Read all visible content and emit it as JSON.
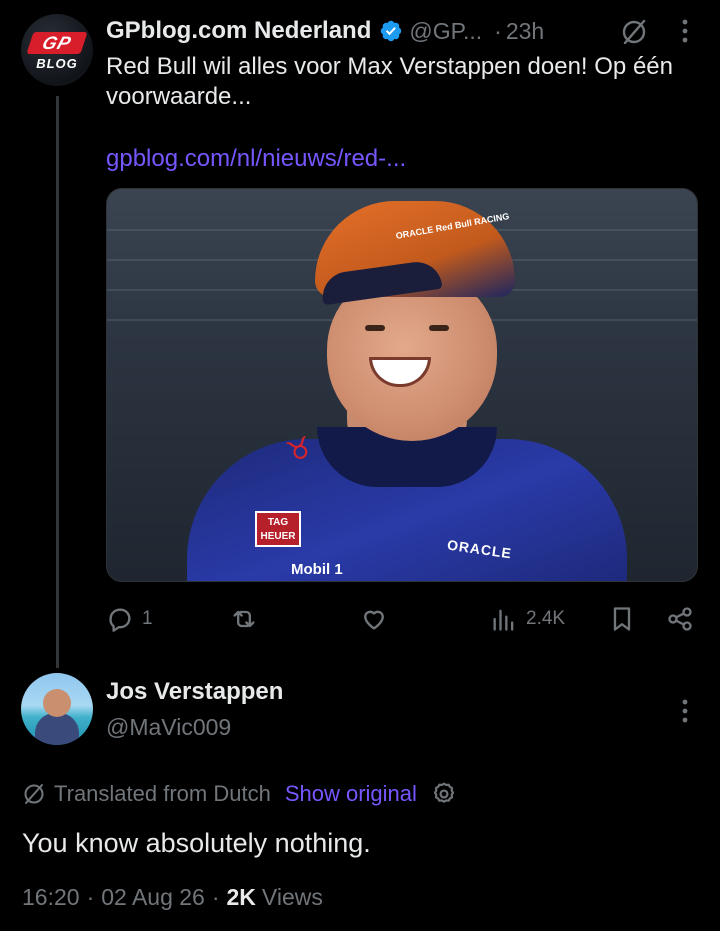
{
  "tweet1": {
    "author_name": "GPblog.com Nederland",
    "handle": "@GP...",
    "dot": "·",
    "time": "23h",
    "avatar_text_top": "GP",
    "avatar_text_bottom": "BLOG",
    "text": "Red Bull wil alles voor Max Verstappen doen! Op één voorwaarde...",
    "link": "gpblog.com/nl/nieuws/red-...",
    "image_labels": {
      "cap": "ORACLE Red Bull RACING",
      "tag": "TAG HEUER",
      "mobil": "Mobil 1",
      "oracle": "ORACLE"
    },
    "actions": {
      "replies": "1",
      "retweets": "",
      "likes": "",
      "views": "2.4K"
    }
  },
  "tweet2": {
    "author_name": "Jos Verstappen",
    "handle": "@MaVic009",
    "translated_label": "Translated from Dutch",
    "show_original": "Show original",
    "text": "You know absolutely nothing.",
    "time": "16:20",
    "sep1": "·",
    "date": "02 Aug 26",
    "sep2": "·",
    "views_count": "2K",
    "views_label": "Views"
  },
  "colors": {
    "background": "#000000",
    "text": "#e7e9ea",
    "muted": "#71767b",
    "link": "#7856ff",
    "verified": "#1d9bf0"
  }
}
